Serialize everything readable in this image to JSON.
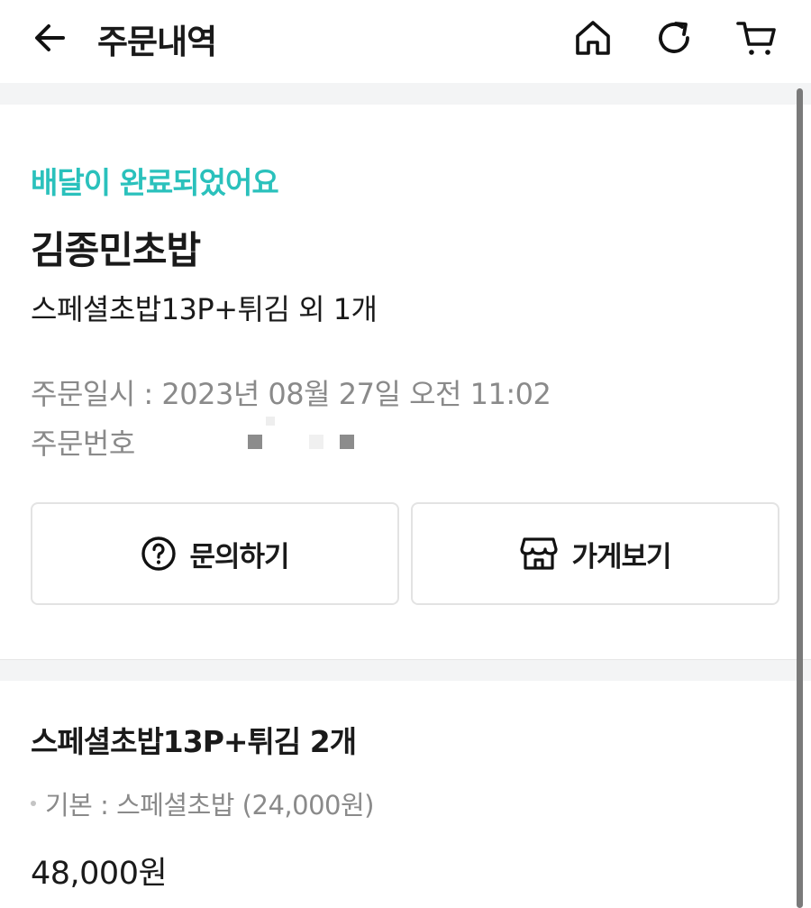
{
  "header": {
    "title": "주문내역",
    "icons": [
      "back-arrow-icon",
      "home-icon",
      "refresh-icon",
      "cart-icon"
    ]
  },
  "order": {
    "status": "배달이 완료되었어요",
    "store_name": "김종민초밥",
    "summary": "스페셜초밥13P+튀김 외 1개",
    "date": "주문일시 : 2023년 08월 27일 오전 11:02",
    "number_label": "주문번호"
  },
  "actions": {
    "inquiry_label": "문의하기",
    "store_label": "가게보기"
  },
  "item": {
    "title": "스페셜초밥13P+튀김 2개",
    "option": "기본 : 스페셜초밥 (24,000원)",
    "price": "48,000원"
  },
  "colors": {
    "accent": "#2ac1bc",
    "muted_text": "#8a8a8a",
    "divider": "#f3f4f5"
  }
}
